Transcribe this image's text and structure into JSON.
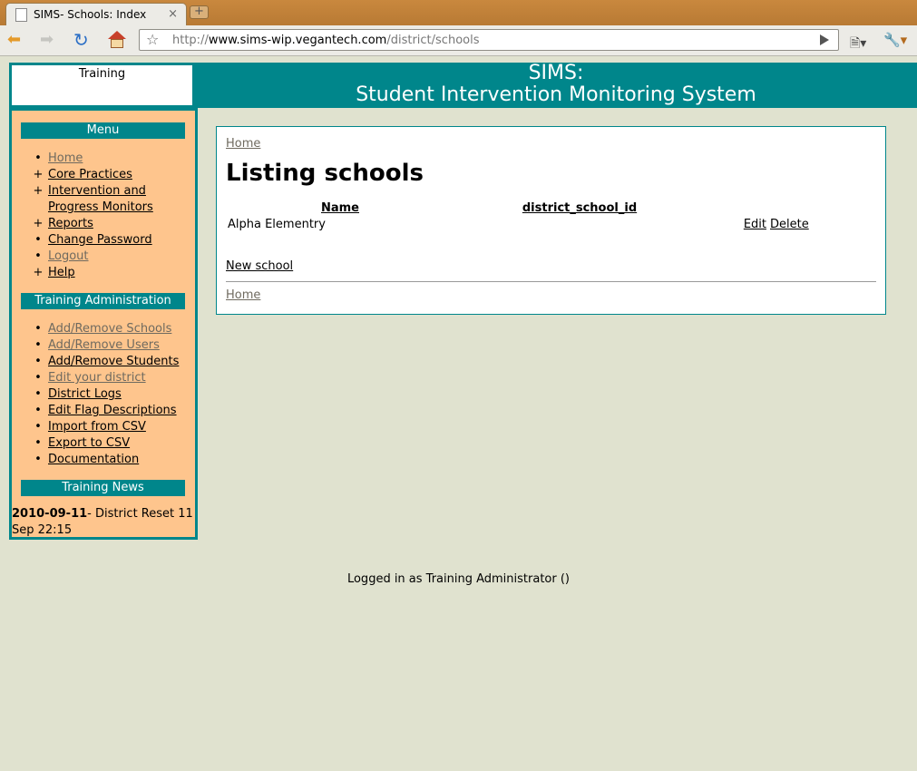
{
  "browser": {
    "tab_title": "SIMS- Schools: Index",
    "tab_close": "×",
    "new_tab": "+",
    "url_prefix": "http://",
    "url_host": "www.sims-wip.vegantech.com",
    "url_path": "/district/schools"
  },
  "header": {
    "logo_text": "Training",
    "title_line1": "SIMS:",
    "title_line2": "Student Intervention Monitoring System"
  },
  "sidebar": {
    "menu_heading": "Menu",
    "menu_items": [
      {
        "label": "Home"
      },
      {
        "label": "Core Practices"
      },
      {
        "label": "Intervention and Progress Monitors"
      },
      {
        "label": "Reports"
      },
      {
        "label": "Change Password"
      },
      {
        "label": "Logout"
      },
      {
        "label": "Help"
      }
    ],
    "admin_heading": "Training Administration",
    "admin_items": [
      {
        "label": "Add/Remove Schools"
      },
      {
        "label": "Add/Remove Users"
      },
      {
        "label": "Add/Remove Students"
      },
      {
        "label": "Edit your district"
      },
      {
        "label": "District Logs"
      },
      {
        "label": "Edit Flag Descriptions"
      },
      {
        "label": "Import from CSV"
      },
      {
        "label": "Export to CSV"
      },
      {
        "label": "Documentation"
      }
    ],
    "news_heading": "Training News",
    "news": {
      "date": "2010-09-11",
      "text": "- District Reset 11 Sep 22:15"
    }
  },
  "main": {
    "breadcrumb_top": "Home",
    "heading": "Listing schools",
    "table": {
      "columns": [
        "Name",
        "district_school_id"
      ],
      "rows": [
        {
          "name": "Alpha Elementry",
          "district_school_id": "",
          "edit_label": "Edit",
          "delete_label": "Delete"
        }
      ]
    },
    "new_school_label": "New school",
    "breadcrumb_bottom": "Home"
  },
  "footer": {
    "status_text": "Logged in as Training Administrator ()"
  }
}
